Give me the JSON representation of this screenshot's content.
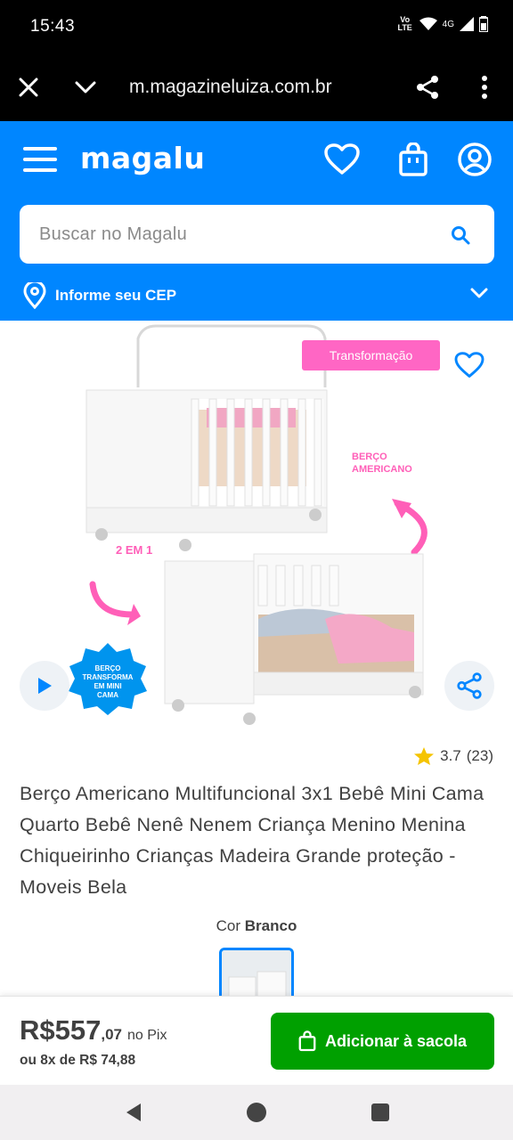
{
  "status_bar": {
    "time": "15:43",
    "volte": "Vo LTE",
    "network": "4G"
  },
  "browser": {
    "url": "m.magazineluiza.com.br"
  },
  "header": {
    "logo": "magalu",
    "search": {
      "placeholder": "Buscar no Magalu"
    },
    "cep_label": "Informe seu CEP",
    "brand_color": "#0086ff"
  },
  "product": {
    "image_texts": {
      "badge": "Transformação",
      "label_american": "BERÇO AMERICANO",
      "label_2em1": "2 EM 1",
      "seal": "BERÇO TRANSFORMA EM MINI CAMA"
    },
    "rating": {
      "score": "3.7",
      "count": "(23)"
    },
    "title": "Berço Americano Multifuncional 3x1 Bebê Mini Cama Quarto Bebê Nenê Nenem Criança Menino Menina Chiqueirinho Crianças Madeira Grande proteção - Moveis Bela",
    "color": {
      "label": "Cor",
      "value": "Branco"
    }
  },
  "purchase": {
    "price_main": "R$557",
    "price_cents": ",07",
    "price_suffix": "no Pix",
    "installments": "ou 8x de R$ 74,88",
    "add_button": "Adicionar à sacola",
    "button_color": "#00a000"
  },
  "icons": [
    "close-icon",
    "chevron-down-icon",
    "share-icon",
    "more-vert-icon",
    "menu-icon",
    "heart-icon",
    "bag-icon",
    "user-icon",
    "search-icon",
    "location-pin-icon",
    "play-icon",
    "star-icon",
    "back-icon",
    "home-icon",
    "recents-icon"
  ]
}
